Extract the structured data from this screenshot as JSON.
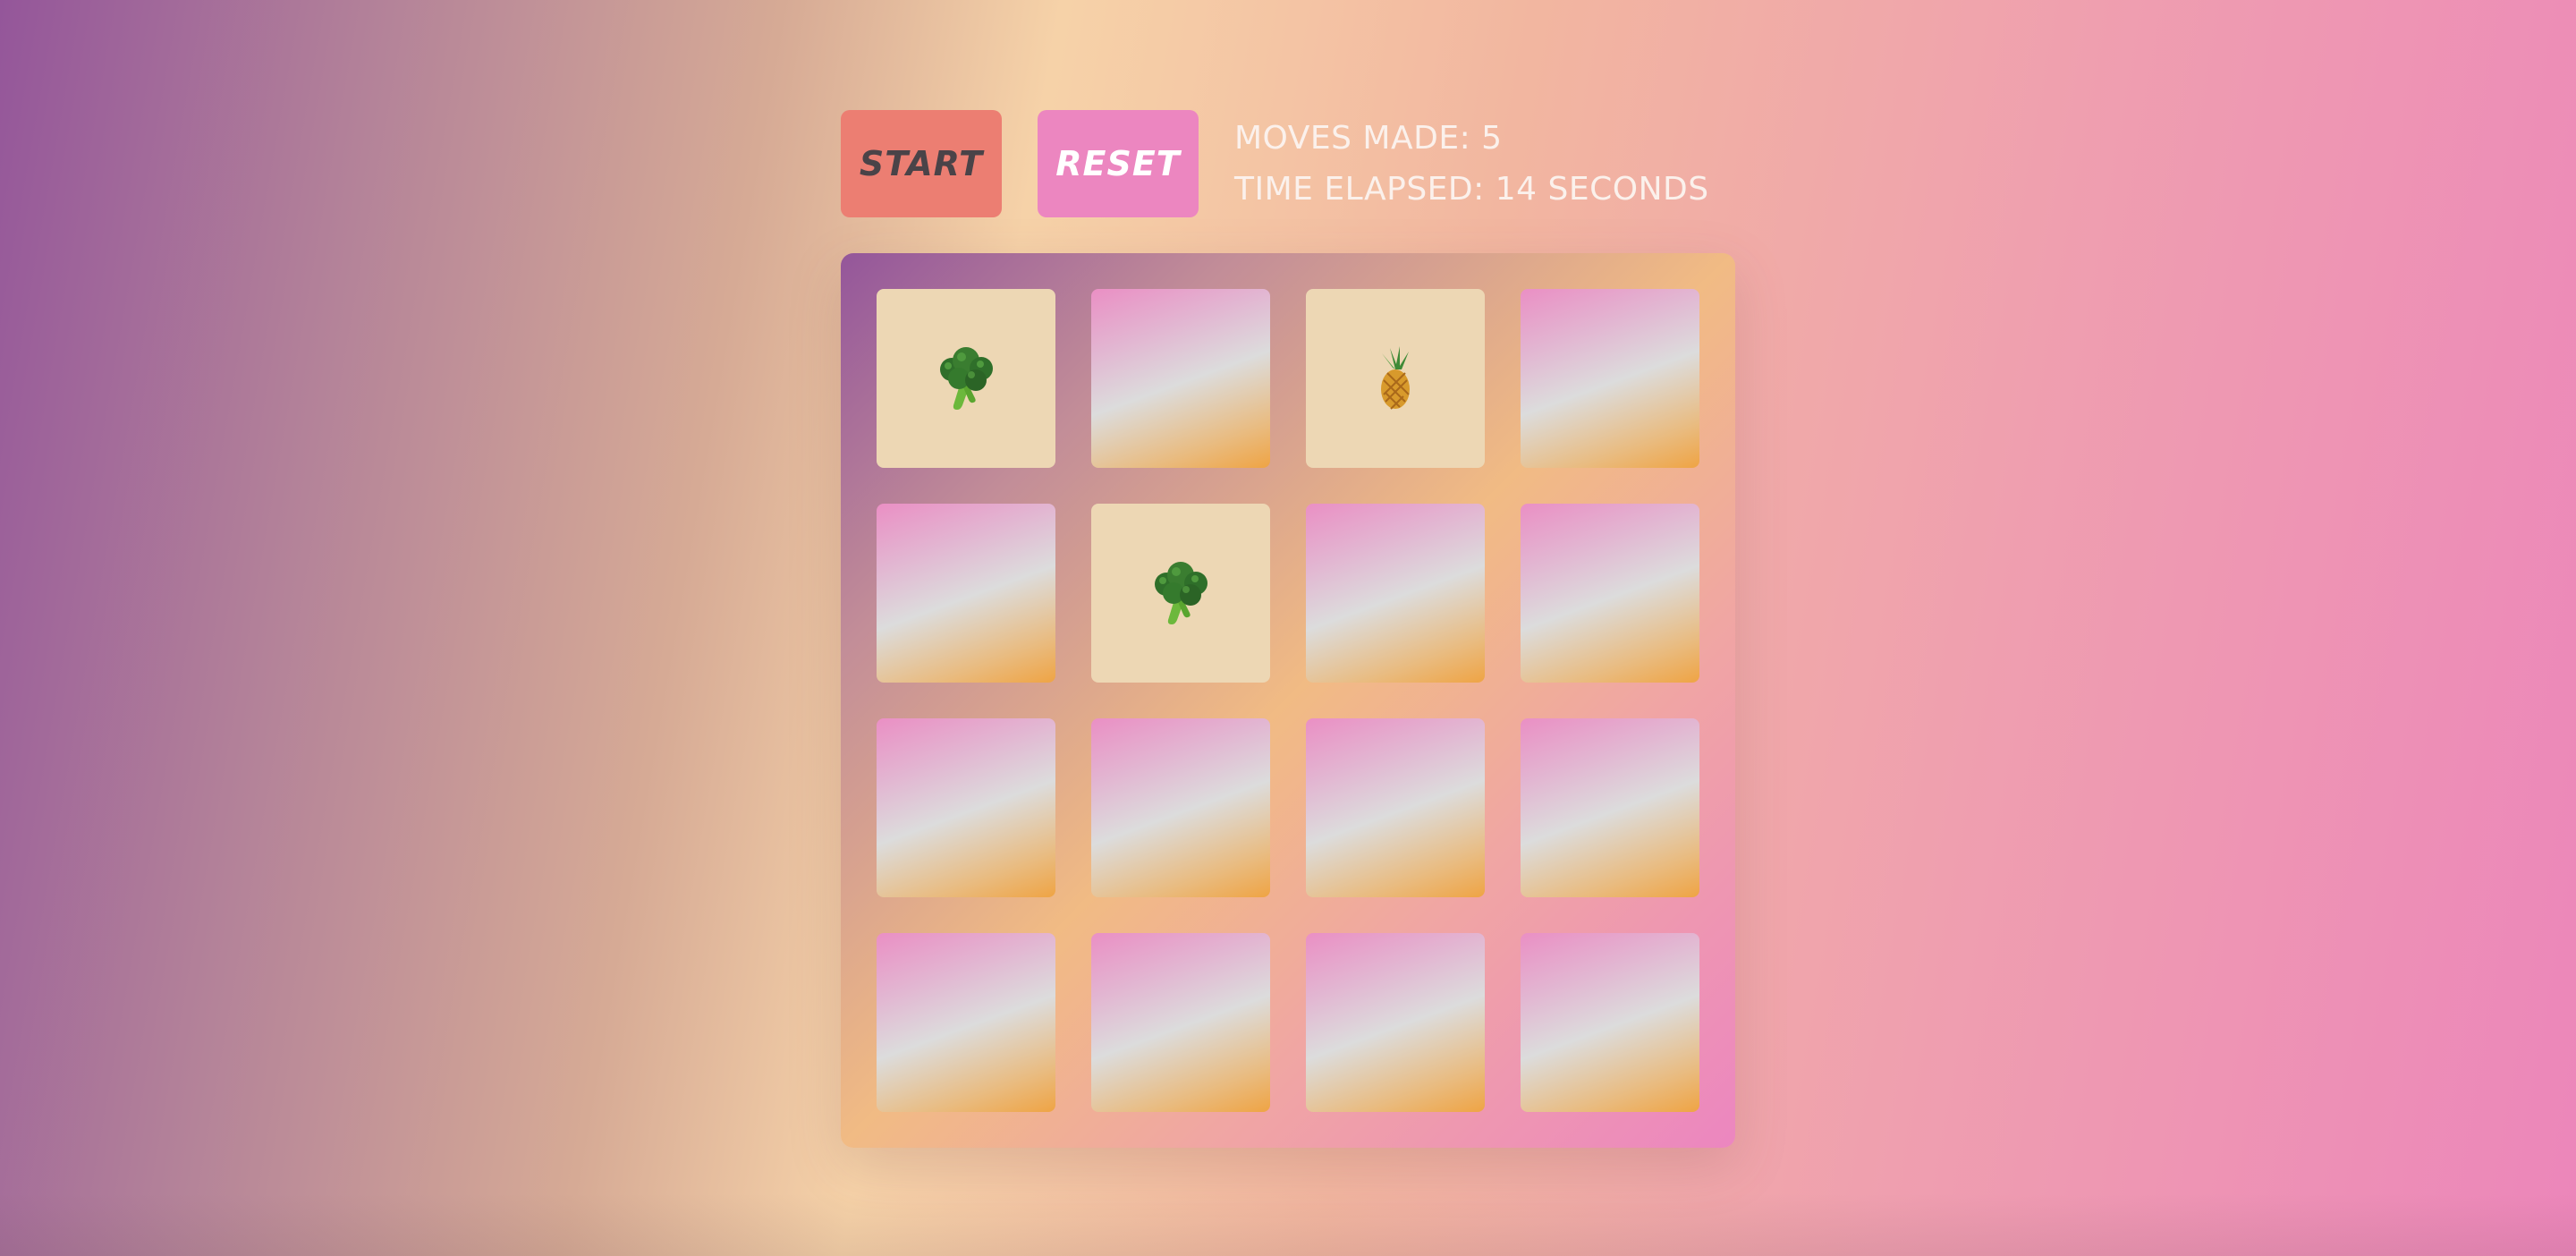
{
  "controls": {
    "start_label": "START",
    "reset_label": "RESET"
  },
  "stats": {
    "moves_label": "MOVES MADE:",
    "moves_value": "5",
    "time_label": "TIME ELAPSED:",
    "time_value": "14",
    "time_unit": "SECONDS"
  },
  "colors": {
    "start_button": "#ec7e72",
    "reset_button": "#ec86c0",
    "revealed_card": "#edd7b4"
  },
  "board": {
    "rows": 4,
    "columns": 4,
    "cards": [
      {
        "state": "revealed",
        "icon": "broccoli-icon"
      },
      {
        "state": "hidden"
      },
      {
        "state": "revealed",
        "icon": "pineapple-icon"
      },
      {
        "state": "hidden"
      },
      {
        "state": "hidden"
      },
      {
        "state": "revealed",
        "icon": "broccoli-icon"
      },
      {
        "state": "hidden"
      },
      {
        "state": "hidden"
      },
      {
        "state": "hidden"
      },
      {
        "state": "hidden"
      },
      {
        "state": "hidden"
      },
      {
        "state": "hidden"
      },
      {
        "state": "hidden"
      },
      {
        "state": "hidden"
      },
      {
        "state": "hidden"
      },
      {
        "state": "hidden"
      }
    ]
  }
}
